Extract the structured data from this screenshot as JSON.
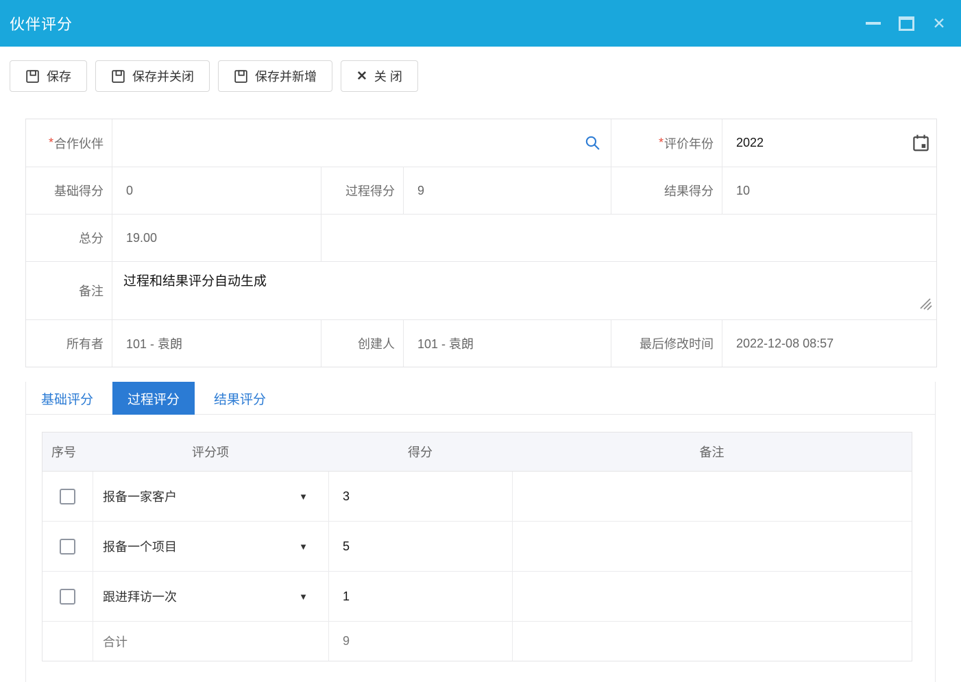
{
  "window": {
    "title": "伙伴评分"
  },
  "toolbar": {
    "save_label": "保存",
    "save_close_label": "保存并关闭",
    "save_new_label": "保存并新增",
    "close_label": "关 闭"
  },
  "form": {
    "required_mark": "*",
    "partner": {
      "label": "合作伙伴",
      "value": ""
    },
    "year": {
      "label": "评价年份",
      "value": "2022"
    },
    "base_score": {
      "label": "基础得分",
      "value": "0"
    },
    "process_score": {
      "label": "过程得分",
      "value": "9"
    },
    "result_score": {
      "label": "结果得分",
      "value": "10"
    },
    "total_score": {
      "label": "总分",
      "value": "19.00"
    },
    "remark": {
      "label": "备注",
      "value": "过程和结果评分自动生成"
    },
    "owner": {
      "label": "所有者",
      "value": "101 - 袁朗"
    },
    "creator": {
      "label": "创建人",
      "value": "101 - 袁朗"
    },
    "modified": {
      "label": "最后修改时间",
      "value": "2022-12-08 08:57"
    }
  },
  "tabs": [
    {
      "label": "基础评分",
      "active": false
    },
    {
      "label": "过程评分",
      "active": true
    },
    {
      "label": "结果评分",
      "active": false
    }
  ],
  "score_table": {
    "headers": {
      "index": "序号",
      "item": "评分项",
      "score": "得分",
      "remark": "备注"
    },
    "rows": [
      {
        "item": "报备一家客户",
        "score": "3",
        "remark": ""
      },
      {
        "item": "报备一个项目",
        "score": "5",
        "remark": ""
      },
      {
        "item": "跟进拜访一次",
        "score": "1",
        "remark": ""
      }
    ],
    "total": {
      "label": "合计",
      "score": "9"
    }
  },
  "icons": {
    "caret_down": "▼",
    "close_glyph": "✕"
  },
  "colors": {
    "titlebar_blue": "#1AA7DC",
    "accent_blue": "#2B7BD4",
    "required_red": "#E74C3C",
    "table_header_bg": "#F5F6FA",
    "border_gray": "#E4E4E6"
  }
}
